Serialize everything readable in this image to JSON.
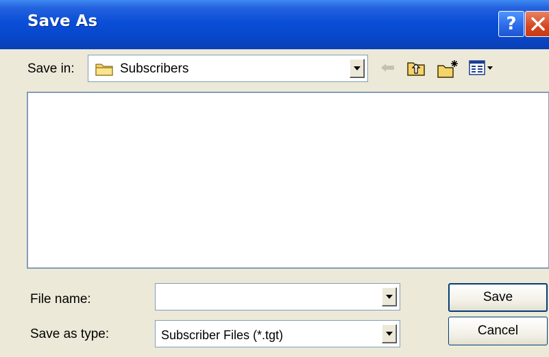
{
  "window": {
    "title": "Save As",
    "help_button": "?"
  },
  "save_in": {
    "label": "Save in:",
    "value": "Subscribers"
  },
  "toolbar": {
    "icons": [
      "back-arrow-icon",
      "up-folder-icon",
      "new-folder-icon",
      "views-menu-icon"
    ]
  },
  "file_name": {
    "label": "File name:",
    "value": ""
  },
  "save_as_type": {
    "label": "Save as type:",
    "value": "Subscriber Files (*.tgt)"
  },
  "buttons": {
    "save": "Save",
    "cancel": "Cancel"
  },
  "colors": {
    "title_bar": "#0a4ed8",
    "dialog_face": "#ece9d8",
    "field_border": "#7f9db9",
    "close_button": "#d8461f"
  }
}
